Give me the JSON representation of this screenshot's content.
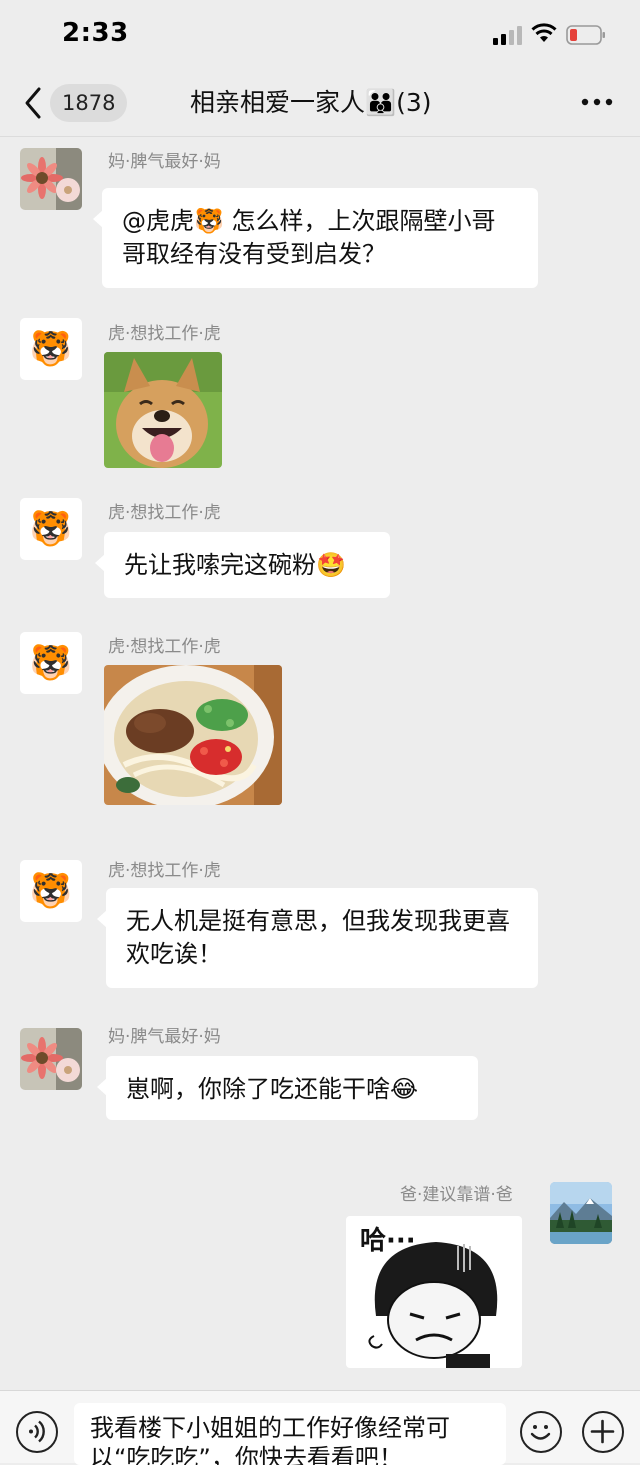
{
  "status_bar": {
    "time": "2:33"
  },
  "nav": {
    "unread_count": "1878",
    "title": "相亲相爱一家人👪(3)"
  },
  "messages": [
    {
      "sender": "妈·脾气最好·妈",
      "type": "text",
      "text": "@虎虎🐯 怎么样，上次跟隔壁小哥哥取经有没有受到启发？"
    },
    {
      "sender": "虎·想找工作·虎",
      "type": "image",
      "image": "smiling-shiba-dog-photo"
    },
    {
      "sender": "虎·想找工作·虎",
      "type": "text",
      "text": "先让我嗦完这碗粉🤩"
    },
    {
      "sender": "虎·想找工作·虎",
      "type": "image",
      "image": "rice-noodle-bowl-photo"
    },
    {
      "sender": "虎·想找工作·虎",
      "type": "text",
      "text": "无人机是挺有意思，但我发现我更喜欢吃诶！"
    },
    {
      "sender": "妈·脾气最好·妈",
      "type": "text",
      "text": "崽啊，你除了吃还能干啥😂"
    },
    {
      "sender": "爸·建议靠谱·爸",
      "type": "sticker",
      "sticker_text": "哈···"
    }
  ],
  "input": {
    "text": "我看楼下小姐姐的工作好像经常可以“吃吃吃”，你快去看看吧！"
  },
  "colors": {
    "background": "#ededed",
    "bubble": "#ffffff",
    "meta_text": "#8a8a8a",
    "battery_low": "#e5423b"
  }
}
